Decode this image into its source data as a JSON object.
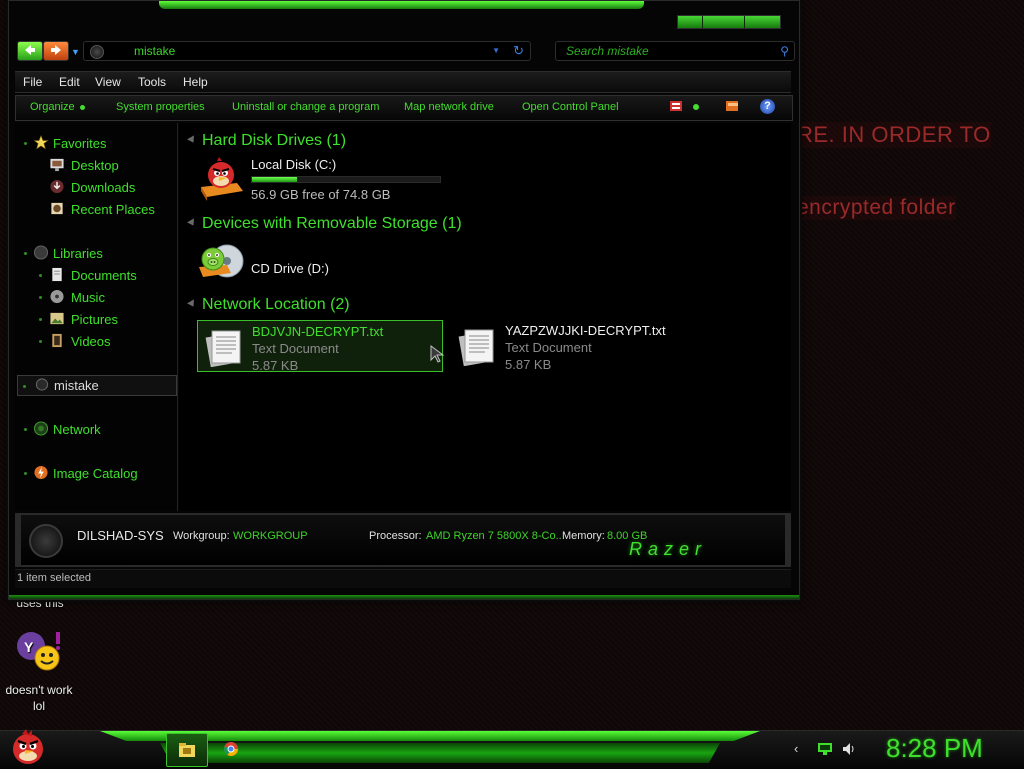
{
  "desktop": {
    "ransom_line1": "RE. IN ORDER TO",
    "ransom_line2": "encrypted folder",
    "icon1_label": "uses this",
    "icon2_label": "doesn't work lol"
  },
  "window": {
    "address": "mistake",
    "search_placeholder": "Search mistake",
    "menu": [
      "File",
      "Edit",
      "View",
      "Tools",
      "Help"
    ],
    "toolbar": {
      "organize": "Organize",
      "system_properties": "System properties",
      "uninstall": "Uninstall or change a program",
      "map_drive": "Map network drive",
      "control_panel": "Open Control Panel"
    },
    "nav": {
      "favorites": "Favorites",
      "desktop": "Desktop",
      "downloads": "Downloads",
      "recent_places": "Recent Places",
      "libraries": "Libraries",
      "documents": "Documents",
      "music": "Music",
      "pictures": "Pictures",
      "videos": "Videos",
      "mistake": "mistake",
      "network": "Network",
      "image_catalog": "Image Catalog"
    },
    "groups": {
      "hdd": "Hard Disk Drives (1)",
      "removable": "Devices with Removable Storage (1)",
      "network": "Network Location (2)"
    },
    "local_disk": {
      "name": "Local Disk (C:)",
      "free": "56.9 GB free of 74.8 GB",
      "used_fraction": 0.24
    },
    "cd_drive": {
      "name": "CD Drive (D:)"
    },
    "files": [
      {
        "name": "BDJVJN-DECRYPT.txt",
        "type": "Text Document",
        "size": "5.87 KB"
      },
      {
        "name": "YAZPZWJJKI-DECRYPT.txt",
        "type": "Text Document",
        "size": "5.87 KB"
      }
    ],
    "details": {
      "computer": "DILSHAD-SYS",
      "workgroup_key": "Workgroup:",
      "workgroup_val": "WORKGROUP",
      "processor_key": "Processor:",
      "processor_val": "AMD Ryzen 7 5800X 8-Co...",
      "memory_key": "Memory:",
      "memory_val": "8.00 GB",
      "brand": "Razer"
    },
    "status": "1 item selected"
  },
  "taskbar": {
    "clock": "8:28 PM"
  },
  "colors": {
    "accent": "#3fe02d",
    "ransom_text": "#9a2a2a"
  }
}
